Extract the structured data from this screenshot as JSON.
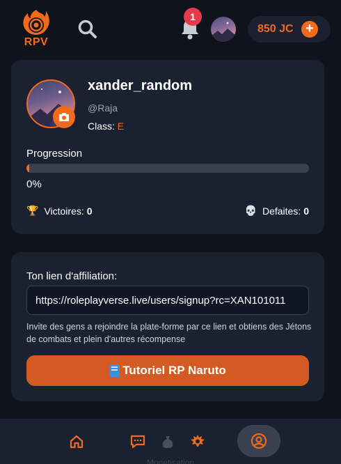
{
  "header": {
    "logo_text": "RPV",
    "notification_count": "1",
    "coins_label": "850 JC",
    "coins_plus": "+"
  },
  "profile": {
    "username": "xander_random",
    "handle": "@Raja",
    "class_label": "Class:",
    "class_value": "E",
    "progression_label": "Progression",
    "progression_value": "0%",
    "progression_fraction": 0.0,
    "victories_label": "Victoires:",
    "victories_value": "0",
    "defeats_label": "Defaites:",
    "defeats_value": "0"
  },
  "affiliation": {
    "title": "Ton lien d'affiliation:",
    "link": "https://roleplayverse.live/users/signup?rc=XAN101011",
    "description": "Invite des gens a rejoindre la plate-forme par ce lien et obtiens des Jétons de combats et plein d'autres récompense",
    "tutorial_button": "Tutoriel RP Naruto"
  },
  "bottom_nav": {
    "caption": "Monetisation",
    "items": [
      "home-icon",
      "chat-icon",
      "money-bag-icon",
      "naruto-icon",
      "profile-icon"
    ]
  },
  "colors": {
    "accent": "#f26a1b",
    "card": "#1a2130",
    "background": "#0f131c",
    "badge": "#e63a4a"
  }
}
